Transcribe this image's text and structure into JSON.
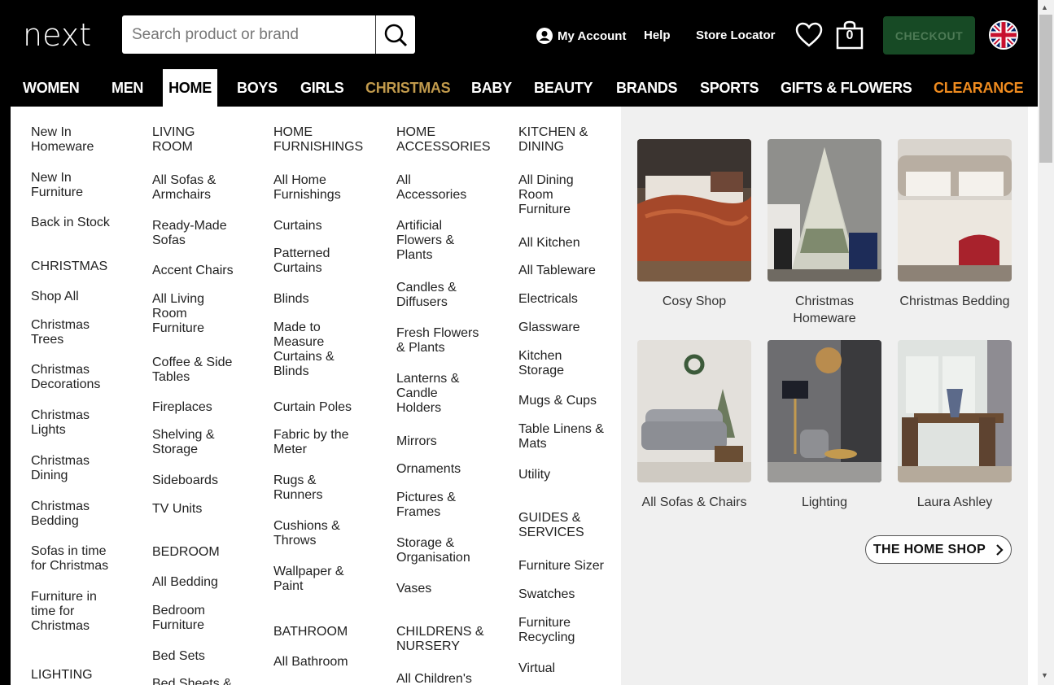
{
  "header": {
    "logo": "next",
    "search_placeholder": "Search product or brand",
    "my_account": "My Account",
    "help": "Help",
    "store_locator": "Store Locator",
    "bag_count": "0",
    "checkout": "CHECKOUT"
  },
  "nav": [
    "WOMEN",
    "MEN",
    "HOME",
    "BOYS",
    "GIRLS",
    "CHRISTMAS",
    "BABY",
    "BEAUTY",
    "BRANDS",
    "SPORTS",
    "GIFTS & FLOWERS",
    "CLEARANCE"
  ],
  "menu": {
    "c1": {
      "links_top": [
        "New In Homeware",
        "New In Furniture",
        "Back in Stock"
      ],
      "h_christmas": "CHRISTMAS",
      "christmas": [
        "Shop All",
        "Christmas Trees",
        "Christmas Decorations",
        "Christmas Lights",
        "Christmas Dining",
        "Christmas Bedding",
        "Sofas in time for Christmas",
        "Furniture in time for Christmas"
      ],
      "h_lighting": "LIGHTING"
    },
    "c2": {
      "h_living": "LIVING ROOM",
      "living": [
        "All Sofas & Armchairs",
        "Ready-Made Sofas",
        "Accent Chairs",
        "All Living Room Furniture",
        "Coffee & Side Tables",
        "Fireplaces",
        "Shelving & Storage",
        "Sideboards",
        "TV Units"
      ],
      "h_bedroom": "BEDROOM",
      "bedroom": [
        "All Bedding",
        "Bedroom Furniture",
        "Bed Sets",
        "Bed Sheets &"
      ]
    },
    "c3": {
      "h_furnishings": "HOME FURNISHINGS",
      "furnishings": [
        "All Home Furnishings",
        "Curtains",
        "Patterned Curtains",
        "Blinds",
        "Made to Measure Curtains & Blinds",
        "Curtain Poles",
        "Fabric by the Meter",
        "Rugs & Runners",
        "Cushions & Throws",
        "Wallpaper & Paint"
      ],
      "h_bathroom": "BATHROOM",
      "bathroom": [
        "All Bathroom"
      ]
    },
    "c4": {
      "h_accessories": "HOME ACCESSORIES",
      "accessories": [
        "All Accessories",
        "Artificial Flowers & Plants",
        "Candles & Diffusers",
        "Fresh Flowers & Plants",
        "Lanterns & Candle Holders",
        "Mirrors",
        "Ornaments",
        "Pictures & Frames",
        "Storage & Organisation",
        "Vases"
      ],
      "h_children": "CHILDRENS & NURSERY",
      "children": [
        "All Children's"
      ]
    },
    "c5": {
      "h_kitchen": "KITCHEN & DINING",
      "kitchen": [
        "All Dining Room Furniture",
        "All Kitchen",
        "All Tableware",
        "Electricals",
        "Glassware",
        "Kitchen Storage",
        "Mugs & Cups",
        "Table Linens & Mats",
        "Utility"
      ],
      "h_guides": "GUIDES & SERVICES",
      "guides": [
        "Furniture Sizer",
        "Swatches",
        "Furniture Recycling",
        "Virtual"
      ]
    }
  },
  "tiles": [
    "Cosy Shop",
    "Christmas Homeware",
    "Christmas Bedding",
    "All Sofas & Chairs",
    "Lighting",
    "Laura Ashley"
  ],
  "home_shop": "THE HOME SHOP",
  "colors": {
    "checkout_bg": "#174a25",
    "christmas_nav": "#c19a4c",
    "clearance_nav": "#ef8b1f"
  }
}
